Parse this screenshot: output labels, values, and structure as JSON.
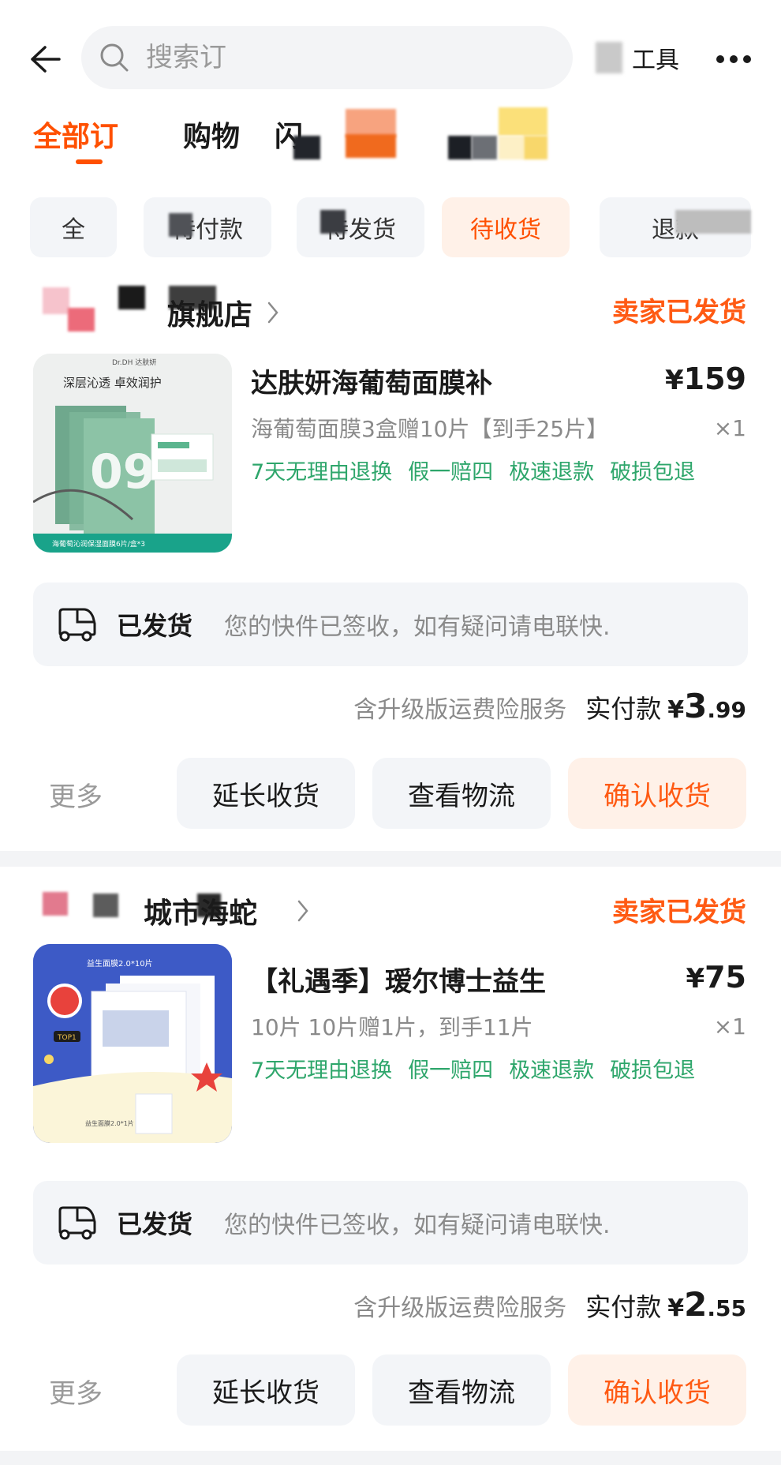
{
  "search": {
    "placeholder": "搜索订"
  },
  "header": {
    "tools_label": "工具"
  },
  "tabs": [
    {
      "label": "全部订",
      "active": true
    },
    {
      "label": "购物"
    },
    {
      "label": "闪"
    }
  ],
  "chips": [
    {
      "label": "全"
    },
    {
      "label": "待付款"
    },
    {
      "label": "待发货"
    },
    {
      "label": "待收货",
      "active": true
    },
    {
      "label": "退款"
    }
  ],
  "orders": [
    {
      "shop_name": "旗舰店",
      "status": "卖家已发货",
      "product": {
        "title": "达肤妍海葡萄面膜补",
        "price_yen": "¥",
        "price": "159",
        "sku": "海葡萄面膜3盒赠10片【到手25片】",
        "qty": "×1",
        "guarantees": [
          "7天无理由退换",
          "假一赔四",
          "极速退款",
          "破损包退"
        ],
        "image_texts": {
          "brand": "Dr.DH 达肤妍",
          "slogan": "深层沁透  卓效润护",
          "bottom": "海葡萄沁润保湿面膜6片/盒*3"
        }
      },
      "logistics": {
        "status": "已发货",
        "message": "您的快件已签收，如有疑问请电联快."
      },
      "payment": {
        "insurance": "含升级版运费险服务",
        "label": "实付款",
        "yen": "¥",
        "int": "3",
        "dec": ".99"
      },
      "actions": {
        "more": "更多",
        "extend": "延长收货",
        "logistics": "查看物流",
        "confirm": "确认收货"
      }
    },
    {
      "shop_name": "城市海蛇",
      "status": "卖家已发货",
      "product": {
        "title": "【礼遇季】瑷尔博士益生",
        "price_yen": "¥",
        "price": "75",
        "sku": "10片 10片赠1片，到手11片",
        "qty": "×1",
        "guarantees": [
          "7天无理由退换",
          "假一赔四",
          "极速退款",
          "破损包退"
        ],
        "image_texts": {
          "top": "益生面膜2.0*10片",
          "badge": "TOP1",
          "bottom": "益生面膜2.0*1片"
        }
      },
      "logistics": {
        "status": "已发货",
        "message": "您的快件已签收，如有疑问请电联快."
      },
      "payment": {
        "insurance": "含升级版运费险服务",
        "label": "实付款",
        "yen": "¥",
        "int": "2",
        "dec": ".55"
      },
      "actions": {
        "more": "更多",
        "extend": "延长收货",
        "logistics": "查看物流",
        "confirm": "确认收货"
      }
    }
  ],
  "colors": {
    "accent": "#ff5000",
    "status": "#ff5a13",
    "guarantee": "#2ea66b",
    "chip_bg": "#f3f5f8"
  },
  "icons": [
    "back-arrow-icon",
    "search-icon",
    "more-dots-icon",
    "chevron-right-icon",
    "truck-icon"
  ]
}
